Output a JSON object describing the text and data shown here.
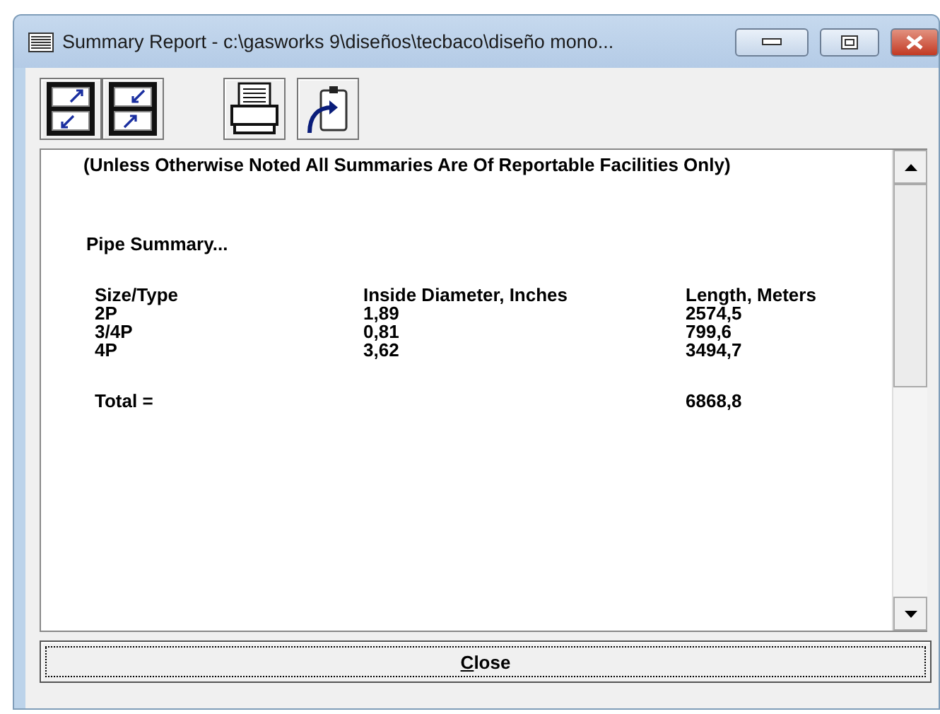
{
  "window": {
    "title": "Summary Report - c:\\gasworks 9\\diseños\\tecbaco\\diseño mono..."
  },
  "report": {
    "note": "(Unless Otherwise Noted All Summaries Are Of Reportable Facilities Only)",
    "heading": "Pipe Summary...",
    "columns": [
      "Size/Type",
      "Inside Diameter, Inches",
      "Length, Meters"
    ],
    "rows": [
      [
        "2P",
        "1,89",
        "2574,5"
      ],
      [
        "3/4P",
        "0,81",
        "799,6"
      ],
      [
        "4P",
        "3,62",
        "3494,7"
      ]
    ],
    "total": {
      "label": "Total =",
      "value": "6868,8"
    }
  },
  "buttons": [
    "Close"
  ]
}
